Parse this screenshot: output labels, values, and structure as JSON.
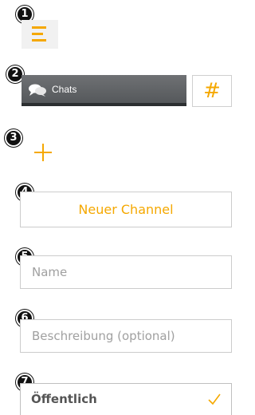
{
  "colors": {
    "accent": "#f5a800",
    "badge": "#111111",
    "header_bar": "#5f6265",
    "border": "#cccccc",
    "placeholder": "#a0a0a0"
  },
  "badges": [
    "1",
    "2",
    "3",
    "4",
    "5",
    "6",
    "7"
  ],
  "menu_button": {
    "icon": "hamburger-menu-icon"
  },
  "chats_tab": {
    "icon": "chat-bubbles-icon",
    "label": "Chats"
  },
  "channel_button": {
    "icon": "hash-icon",
    "symbol": "#"
  },
  "add_button": {
    "icon": "plus-icon"
  },
  "new_channel_button": {
    "label": "Neuer Channel"
  },
  "name_field": {
    "placeholder": "Name",
    "value": ""
  },
  "description_field": {
    "placeholder": "Beschreibung (optional)",
    "value": ""
  },
  "visibility_select": {
    "label": "Öffentlich",
    "icon": "checkmark-icon"
  }
}
